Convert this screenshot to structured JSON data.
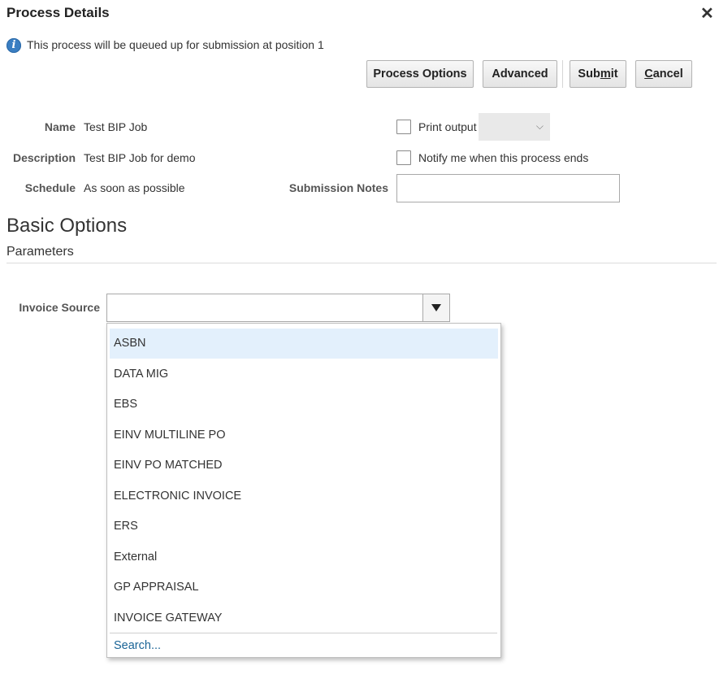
{
  "dialog": {
    "title": "Process Details",
    "close_icon": "close-icon"
  },
  "info": {
    "icon": "info-icon",
    "message": "This process will be queued up for submission at position 1"
  },
  "buttons": {
    "process_options": "Process Options",
    "advanced": "Advanced",
    "submit": {
      "pre": "Sub",
      "mnemonic": "m",
      "post": "it"
    },
    "cancel": {
      "mnemonic": "C",
      "post": "ancel"
    }
  },
  "fields": {
    "name": {
      "label": "Name",
      "value": "Test BIP Job"
    },
    "description": {
      "label": "Description",
      "value": "Test BIP Job for demo"
    },
    "schedule": {
      "label": "Schedule",
      "value": "As soon as possible"
    },
    "print_output": {
      "label": "Print output",
      "checked": false,
      "selected_value": ""
    },
    "notify": {
      "label": "Notify me when this process ends",
      "checked": false
    },
    "submission_notes": {
      "label": "Submission Notes",
      "value": ""
    }
  },
  "basic_options": {
    "title": "Basic Options",
    "subtitle": "Parameters"
  },
  "invoice_source": {
    "label": "Invoice Source",
    "value": "",
    "options": [
      "ASBN",
      "DATA MIG",
      "EBS",
      "EINV MULTILINE PO",
      "EINV PO MATCHED",
      "ELECTRONIC INVOICE",
      "ERS",
      "External",
      "GP APPRAISAL",
      "INVOICE GATEWAY"
    ],
    "highlighted_index": 0,
    "search_link": "Search..."
  },
  "colors": {
    "highlight": "#e3f0fc",
    "link": "#1a6496",
    "info": "#3a7ec2"
  }
}
